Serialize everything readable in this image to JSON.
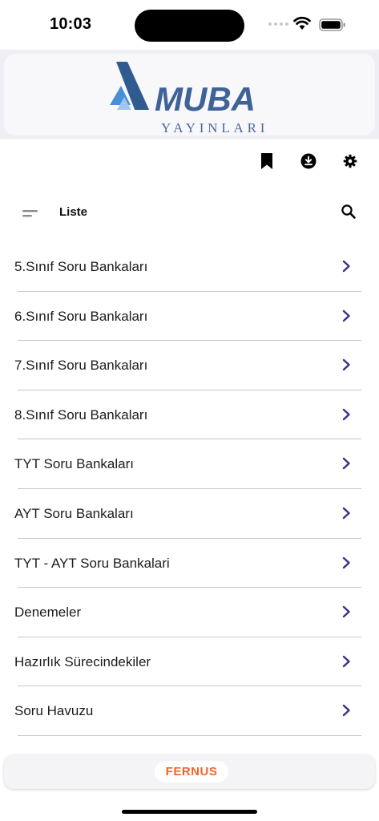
{
  "status_bar": {
    "time": "10:03"
  },
  "header": {
    "brand_name": "MUBA",
    "brand_sub": "YAYINLARI",
    "brand_color": "#3f6397"
  },
  "toolbar": {
    "icons": [
      "bookmark-icon",
      "download-icon",
      "settings-icon"
    ]
  },
  "list_header": {
    "title": "Liste"
  },
  "categories": [
    {
      "label": "5.Sınıf Soru Bankaları"
    },
    {
      "label": "6.Sınıf Soru Bankaları"
    },
    {
      "label": "7.Sınıf Soru Bankaları"
    },
    {
      "label": "8.Sınıf Soru Bankaları"
    },
    {
      "label": "TYT Soru Bankaları"
    },
    {
      "label": "AYT Soru Bankaları"
    },
    {
      "label": "TYT - AYT Soru Bankalari"
    },
    {
      "label": "Denemeler"
    },
    {
      "label": "Hazırlık Sürecindekiler"
    },
    {
      "label": "Soru Havuzu"
    }
  ],
  "footer": {
    "brand": "FERNUS",
    "brand_color": "#f0642d"
  },
  "colors": {
    "chevron": "#3b2f8a",
    "accent": "#3f6397"
  }
}
